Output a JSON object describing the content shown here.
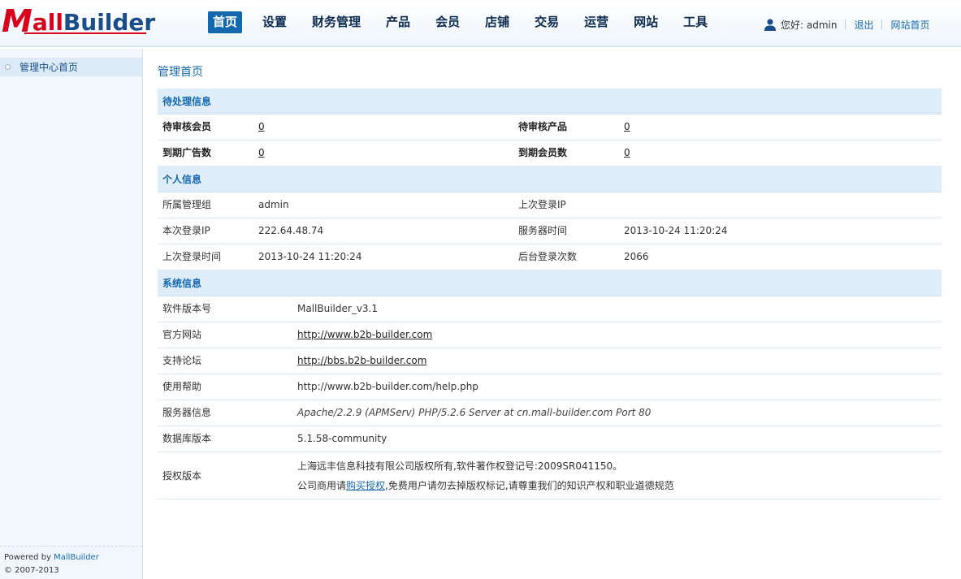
{
  "logo": {
    "m": "M",
    "part1": "all",
    "part2": "Builder"
  },
  "nav": [
    {
      "label": "首页",
      "active": true
    },
    {
      "label": "设置"
    },
    {
      "label": "财务管理"
    },
    {
      "label": "产品"
    },
    {
      "label": "会员"
    },
    {
      "label": "店铺"
    },
    {
      "label": "交易"
    },
    {
      "label": "运营"
    },
    {
      "label": "网站"
    },
    {
      "label": "工具"
    }
  ],
  "userbar": {
    "greeting": "您好: admin",
    "logout": "退出",
    "site_home": "网站首页"
  },
  "sidebar": {
    "home": "管理中心首页",
    "powered_prefix": "Powered by ",
    "powered_brand": "MallBuilder",
    "copyright": "© 2007-2013"
  },
  "page_title": "管理首页",
  "pending": {
    "title": "待处理信息",
    "pending_members_label": "待审核会员",
    "pending_members_value": "0",
    "pending_products_label": "待审核产品",
    "pending_products_value": "0",
    "expired_ads_label": "到期广告数",
    "expired_ads_value": "0",
    "expired_members_label": "到期会员数",
    "expired_members_value": "0"
  },
  "personal": {
    "title": "个人信息",
    "group_label": "所属管理组",
    "group_value": "admin",
    "last_ip_label": "上次登录IP",
    "last_ip_value": "",
    "this_ip_label": "本次登录IP",
    "this_ip_value": "222.64.48.74",
    "server_time_label": "服务器时间",
    "server_time_value": "2013-10-24 11:20:24",
    "last_login_label": "上次登录时间",
    "last_login_value": "2013-10-24 11:20:24",
    "login_count_label": "后台登录次数",
    "login_count_value": "2066"
  },
  "system": {
    "title": "系统信息",
    "version_label": "软件版本号",
    "version_value": "MallBuilder_v3.1",
    "official_label": "官方网站",
    "official_value": "http://www.b2b-builder.com",
    "forum_label": "支持论坛",
    "forum_value": "http://bbs.b2b-builder.com",
    "help_label": "使用帮助",
    "help_value": "http://www.b2b-builder.com/help.php",
    "server_label": "服务器信息",
    "server_value": "Apache/2.2.9 (APMServ) PHP/5.2.6 Server at cn.mall-builder.com Port 80",
    "db_label": "数据库版本",
    "db_value": "5.1.58-community",
    "license_label": "授权版本",
    "license_line1": "上海远丰信息科技有限公司版权所有,软件著作权登记号:2009SR041150。",
    "license_line2_pre": "公司商用请",
    "license_line2_link": "购买授权",
    "license_line2_post": ",免费用户请勿去掉版权标记,请尊重我们的知识产权和职业道德规范"
  },
  "colors": {
    "accent": "#1468b0",
    "logo_red": "#d8001b",
    "section_bg": "#deedf9",
    "sidebar_bg": "#f1f7fc"
  }
}
